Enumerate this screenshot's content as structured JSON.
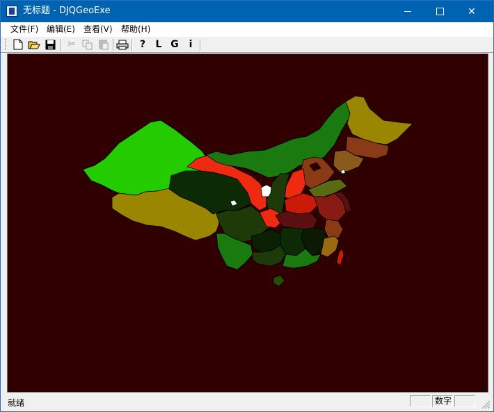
{
  "window": {
    "title": "无标题 - DJQGeoExe"
  },
  "menu": [
    {
      "label": "文件(F)"
    },
    {
      "label": "编辑(E)"
    },
    {
      "label": "查看(V)"
    },
    {
      "label": "帮助(H)"
    }
  ],
  "toolbar": {
    "new_icon": "new-file-icon",
    "open_icon": "open-folder-icon",
    "save_icon": "save-icon",
    "cut_icon": "cut-icon",
    "copy_icon": "copy-icon",
    "paste_icon": "paste-icon",
    "print_icon": "print-icon",
    "help_icon": "help-icon",
    "l_label": "L",
    "g_label": "G",
    "i_label": "i"
  },
  "map": {
    "background": "#300000",
    "regions": [
      {
        "fill": "#22cc00"
      },
      {
        "fill": "#9a8600"
      },
      {
        "fill": "#1a7a10"
      },
      {
        "fill": "#ee2a10"
      },
      {
        "fill": "#0c2a04"
      },
      {
        "fill": "#1e3a08"
      },
      {
        "fill": "#8a3a14"
      },
      {
        "fill": "#ffffff"
      },
      {
        "fill": "#5a1010"
      }
    ]
  },
  "status": {
    "ready": "就绪",
    "num": "数字"
  }
}
